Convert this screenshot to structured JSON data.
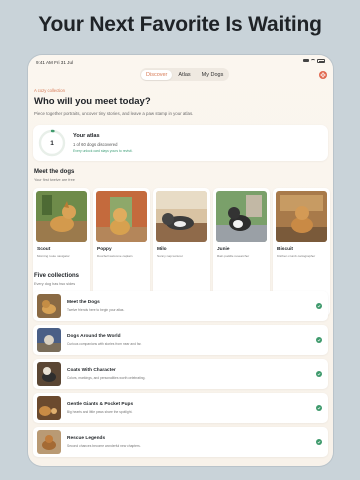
{
  "headline": "Your Next Favorite Is Waiting",
  "status": {
    "time": "9:41 AM  Fri 31 Jul"
  },
  "tabs": [
    "Discover",
    "Atlas",
    "My Dogs"
  ],
  "active_tab": "Discover",
  "intro": {
    "kicker": "A cozy collection",
    "title": "Who will you meet today?",
    "subtitle": "Piece together portraits, uncover tiny stories, and leave a paw stamp in your atlas."
  },
  "atlas": {
    "count": "1",
    "title": "Your atlas",
    "progress_text": "1 of 60 dogs discovered",
    "hint": "Every unlock card stays yours to revisit.",
    "progress_fraction": 0.0167
  },
  "meet": {
    "title": "Meet the dogs",
    "subtitle": "Your first twelve are free",
    "dogs": [
      {
        "name": "Scout",
        "desc": "Morning route navigator"
      },
      {
        "name": "Poppy",
        "desc": "Doorbell welcome captain"
      },
      {
        "name": "Milo",
        "desc": "Sunny nap lecturer"
      },
      {
        "name": "Junie",
        "desc": "Rain puddle researcher"
      },
      {
        "name": "Biscuit",
        "desc": "Kitchen crumb cartographer"
      }
    ]
  },
  "collections": {
    "title": "Five collections",
    "subtitle": "Every dog has two sides",
    "items": [
      {
        "name": "Meet the Dogs",
        "desc": "Twelve friends here to begin your atlas."
      },
      {
        "name": "Dogs Around the World",
        "desc": "Curious companions with stories from near and far."
      },
      {
        "name": "Coats With Character",
        "desc": "Colors, markings, and personalities worth celebrating."
      },
      {
        "name": "Gentle Giants & Pocket Pups",
        "desc": "Big hearts and little paws share the spotlight."
      },
      {
        "name": "Rescue Legends",
        "desc": "Second chances become wonderful new chapters."
      }
    ]
  },
  "colors": {
    "accent": "#d77a55",
    "check": "#3f9a6c",
    "ring": "#3f9a6c"
  }
}
